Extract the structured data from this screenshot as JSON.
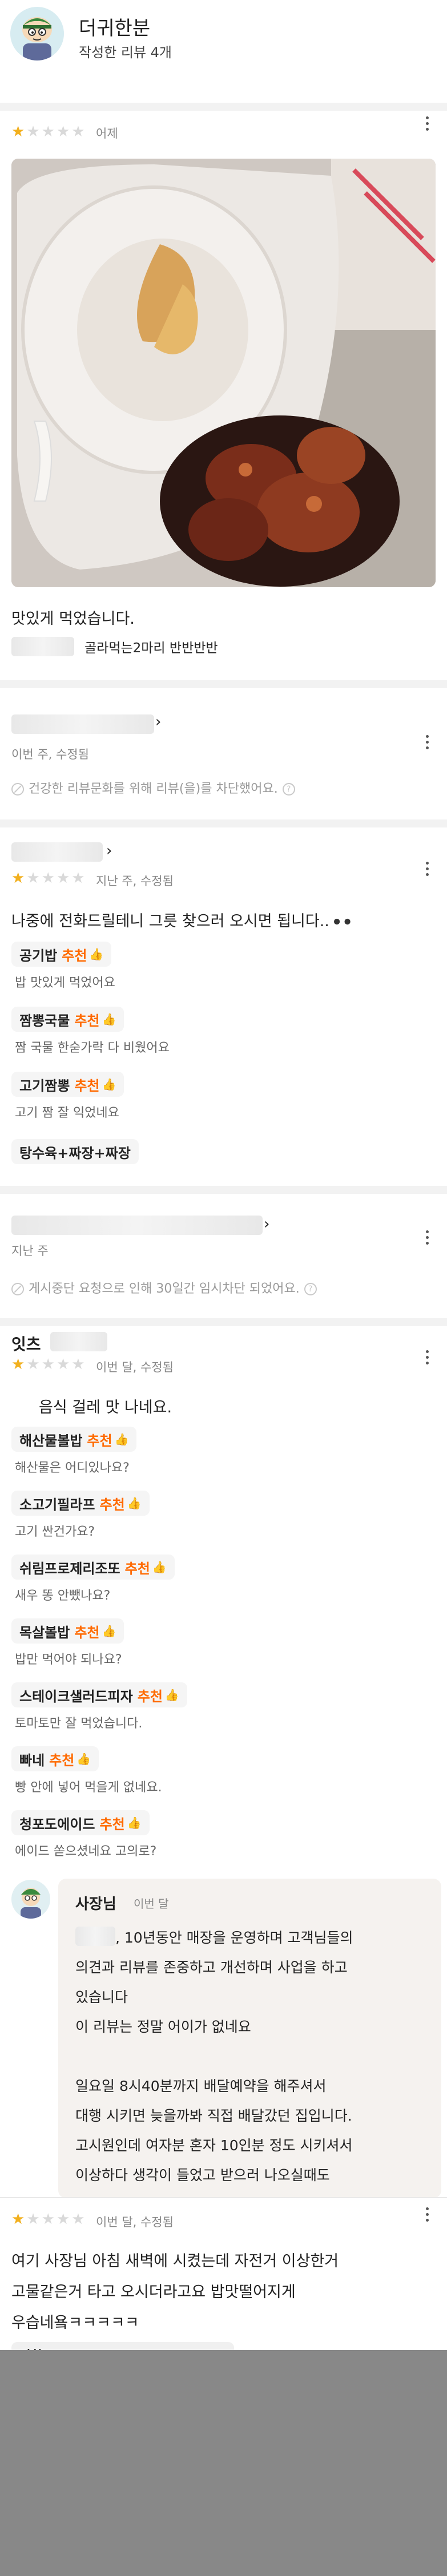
{
  "profile": {
    "name": "더귀한분",
    "review_count": "작성한 리뷰 4개"
  },
  "reviews": [
    {
      "time": "어제",
      "rating": 1,
      "text": "맛있게 먹었습니다.",
      "menu_chip": "골라먹는2마리 반반반반"
    },
    {
      "time": "이번 주, 수정됨",
      "blocked_notice": "건강한 리뷰문화를 위해 리뷰(을)를 차단했어요."
    },
    {
      "time": "지난 주, 수정됨",
      "rating": 1,
      "text": "나중에 전화드릴테니 그릇 찾으러 오시면 됩니다..",
      "emoji": "⚫⚫",
      "menus": [
        {
          "name": "공기밥",
          "rec": "추천",
          "comment": "밥 맛있게 먹었어요"
        },
        {
          "name": "짬뽕국물",
          "rec": "추천",
          "comment": "짬 국물 한숟가락 다 비웠어요"
        },
        {
          "name": "고기짬뽕",
          "rec": "추천",
          "comment": "고기 짬 잘 익었네요"
        }
      ],
      "extra_chip": "탕수육+짜장+짜장"
    },
    {
      "time": "지난 주",
      "blocked_notice": "게시중단 요청으로 인해 30일간 임시차단 되었어요."
    },
    {
      "store": "잇츠",
      "time": "이번 달, 수정됨",
      "rating": 1,
      "text": "음식 걸레 맛 나네요.",
      "menus": [
        {
          "name": "해산물볼밥",
          "rec": "추천",
          "comment": "해산물은 어디있나요?"
        },
        {
          "name": "소고기필라프",
          "rec": "추천",
          "comment": "고기 싼건가요?"
        },
        {
          "name": "쉬림프로제리조또",
          "rec": "추천",
          "comment": "새우 똥 안뺐나요?"
        },
        {
          "name": "목살볼밥",
          "rec": "추천",
          "comment": "밥만 먹어야 되나요?"
        },
        {
          "name": "스테이크샐러드피자",
          "rec": "추천",
          "comment": "토마토만 잘 먹었습니다."
        },
        {
          "name": "빠네",
          "rec": "추천",
          "comment": "빵 안에 넣어 먹을게 없네요."
        },
        {
          "name": "청포도에이드",
          "rec": "추천",
          "comment": "에이드 쏟으셨네요 고의로?"
        }
      ],
      "owner_reply": {
        "title": "사장님",
        "time": "이번 달",
        "lines": [
          ", 10년동안  매장을 운영하며 고객님들의",
          "의견과 리뷰를 존중하고 개선하며 사업을 하고",
          "있습니다",
          "이 리뷰는 정말 어이가 없네요",
          "",
          "일요일 8시40분까지 배달예약을 해주셔서",
          "대행 시키면 늦을까봐 직접 배달갔던 집입니다.",
          "고시원인데 여자분 혼자 10인분 정도 시키셔서",
          "이상하다 생각이 들었고 받으러 나오실때도"
        ]
      }
    },
    {
      "time": "이번 달, 수정됨",
      "rating": 1,
      "lines": [
        "여기 사장님 아침 새벽에 시켰는데 자전거 이상한거",
        "고물같은거 타고 오시더라고요 밥맛떨어지게",
        "우습네욬ㅋㅋㅋㅋㅋ"
      ],
      "cut_chip": "짜한"
    }
  ],
  "colors": {
    "accent": "#ff6a00",
    "star_on": "#f2b01e",
    "star_off": "#d9d9d9",
    "owner_bg": "#f5f2ef"
  }
}
